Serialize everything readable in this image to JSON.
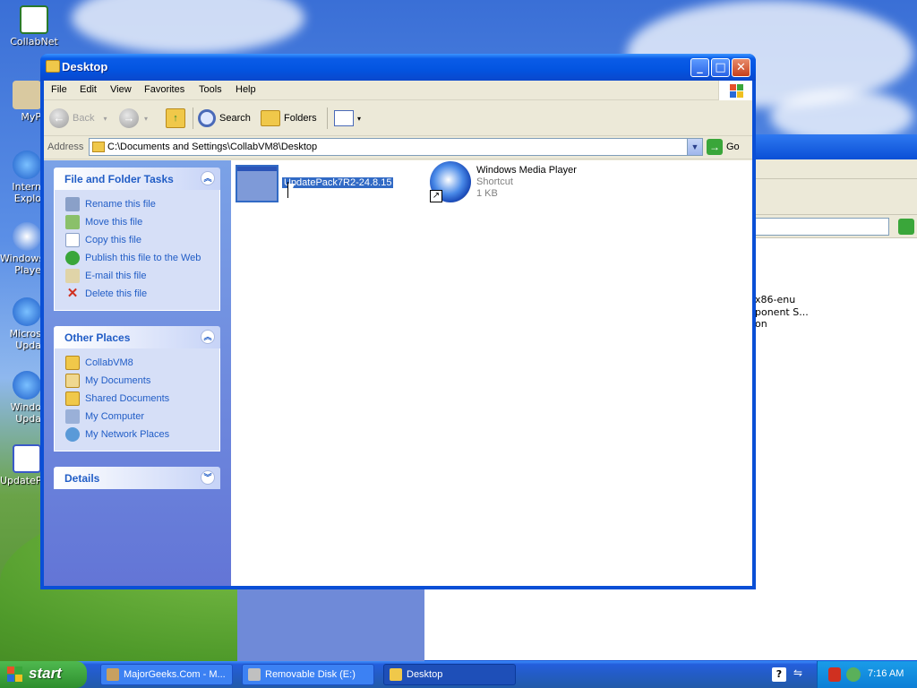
{
  "desktop": {
    "icons": [
      {
        "label": "CollabNet"
      },
      {
        "label": "MyP"
      },
      {
        "label": "Intern Explo"
      },
      {
        "label": "Windows Playe"
      },
      {
        "label": "Micros Upda"
      },
      {
        "label": "Windo Upda"
      },
      {
        "label": "UpdateP"
      }
    ]
  },
  "background_window": {
    "file_name": "x86-enu",
    "file_type": "ponent S...",
    "file_meta": "on"
  },
  "window": {
    "title": "Desktop",
    "menu": [
      "File",
      "Edit",
      "View",
      "Favorites",
      "Tools",
      "Help"
    ],
    "toolbar": {
      "back": "Back",
      "search": "Search",
      "folders": "Folders"
    },
    "address": {
      "label": "Address",
      "value": "C:\\Documents and Settings\\CollabVM8\\Desktop",
      "go": "Go"
    },
    "task_pane": {
      "file_tasks": {
        "title": "File and Folder Tasks",
        "items": [
          {
            "label": "Rename this file",
            "icon": "rename-icon"
          },
          {
            "label": "Move this file",
            "icon": "move-icon"
          },
          {
            "label": "Copy this file",
            "icon": "copy-icon"
          },
          {
            "label": "Publish this file to the Web",
            "icon": "globe-icon"
          },
          {
            "label": "E-mail this file",
            "icon": "email-icon"
          },
          {
            "label": "Delete this file",
            "icon": "delete-icon"
          }
        ]
      },
      "other_places": {
        "title": "Other Places",
        "items": [
          {
            "label": "CollabVM8",
            "icon": "folder-icon"
          },
          {
            "label": "My Documents",
            "icon": "documents-icon"
          },
          {
            "label": "Shared Documents",
            "icon": "folder-icon"
          },
          {
            "label": "My Computer",
            "icon": "computer-icon"
          },
          {
            "label": "My Network Places",
            "icon": "network-icon"
          }
        ]
      },
      "details": {
        "title": "Details"
      }
    },
    "files": [
      {
        "name": "UpdatePack7R2-24.8.15",
        "selected": true
      },
      {
        "name": "Windows Media Player",
        "type": "Shortcut",
        "size": "1 KB"
      }
    ]
  },
  "taskbar": {
    "start": "start",
    "items": [
      {
        "label": "MajorGeeks.Com - M..."
      },
      {
        "label": "Removable Disk (E:)"
      },
      {
        "label": "Desktop",
        "active": true
      }
    ],
    "clock": "7:16 AM"
  },
  "colors": {
    "selection": "#316ac5",
    "link": "#215dc6",
    "titlebar": "#0a5ce8"
  }
}
